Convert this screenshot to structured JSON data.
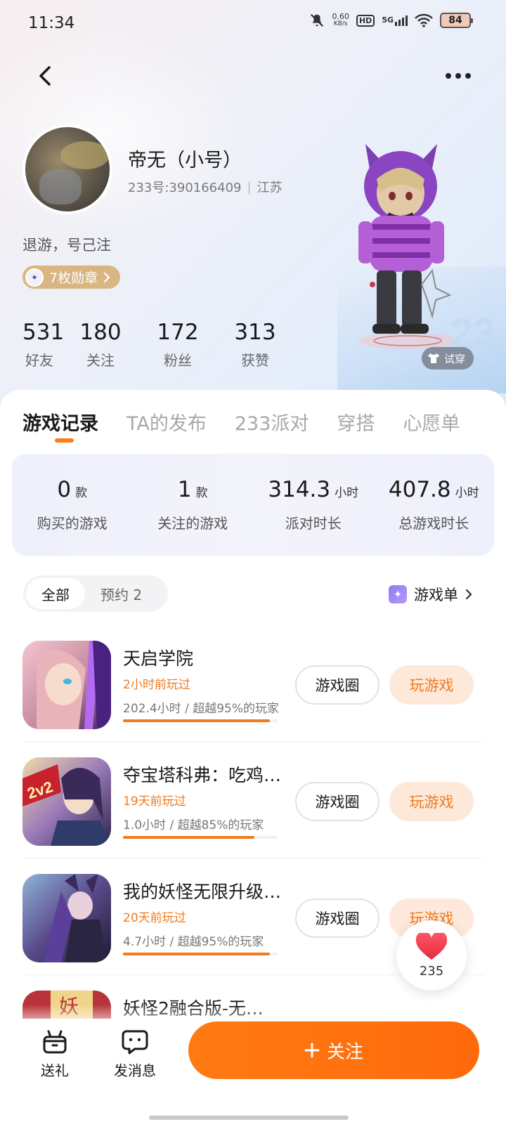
{
  "status_bar": {
    "time": "11:34",
    "net_speed_value": "0.60",
    "net_speed_unit": "KB/s",
    "hd_label": "HD",
    "signal_label": "5G",
    "battery": "84"
  },
  "profile": {
    "name": "帝无（小号）",
    "id_text": "233号:390166409",
    "location": "江苏",
    "bio": "退游，号己注",
    "badges_label": "7枚勋章",
    "stats": [
      {
        "num": "531",
        "label": "好友"
      },
      {
        "num": "180",
        "label": "关注"
      },
      {
        "num": "172",
        "label": "粉丝"
      },
      {
        "num": "313",
        "label": "获赞"
      }
    ],
    "try_on_label": "试穿"
  },
  "tabs": [
    "游戏记录",
    "TA的发布",
    "233派对",
    "穿搭",
    "心愿单"
  ],
  "summary": [
    {
      "num": "0",
      "unit": "款",
      "label": "购买的游戏"
    },
    {
      "num": "1",
      "unit": "款",
      "label": "关注的游戏"
    },
    {
      "num": "314.3",
      "unit": "小时",
      "label": "派对时长"
    },
    {
      "num": "407.8",
      "unit": "小时",
      "label": "总游戏时长"
    }
  ],
  "filters": {
    "all": "全部",
    "reserve": "预约 2",
    "game_list": "游戏单"
  },
  "games": [
    {
      "title": "天启学院",
      "last_played": "2小时前玩过",
      "stat": "202.4小时 / 超越95%的玩家",
      "progress": 0.95,
      "circle_btn": "游戏圈",
      "play_btn": "玩游戏"
    },
    {
      "title": "夺宝塔科弗：吃鸡…",
      "last_played": "19天前玩过",
      "stat": "1.0小时 / 超越85%的玩家",
      "progress": 0.85,
      "circle_btn": "游戏圈",
      "play_btn": "玩游戏"
    },
    {
      "title": "我的妖怪无限升级…",
      "last_played": "20天前玩过",
      "stat": "4.7小时 / 超越95%的玩家",
      "progress": 0.95,
      "circle_btn": "游戏圈",
      "play_btn": "玩游戏"
    },
    {
      "title": "妖怪2融合版-无…"
    }
  ],
  "game_icon_label": "2v2",
  "like": {
    "count": "235"
  },
  "bottom_bar": {
    "gift_label": "送礼",
    "message_label": "发消息",
    "follow_label": "关注"
  },
  "colors": {
    "accent": "#ff7a12",
    "last_played": "#f07a1e",
    "badge": "#d9b582"
  }
}
